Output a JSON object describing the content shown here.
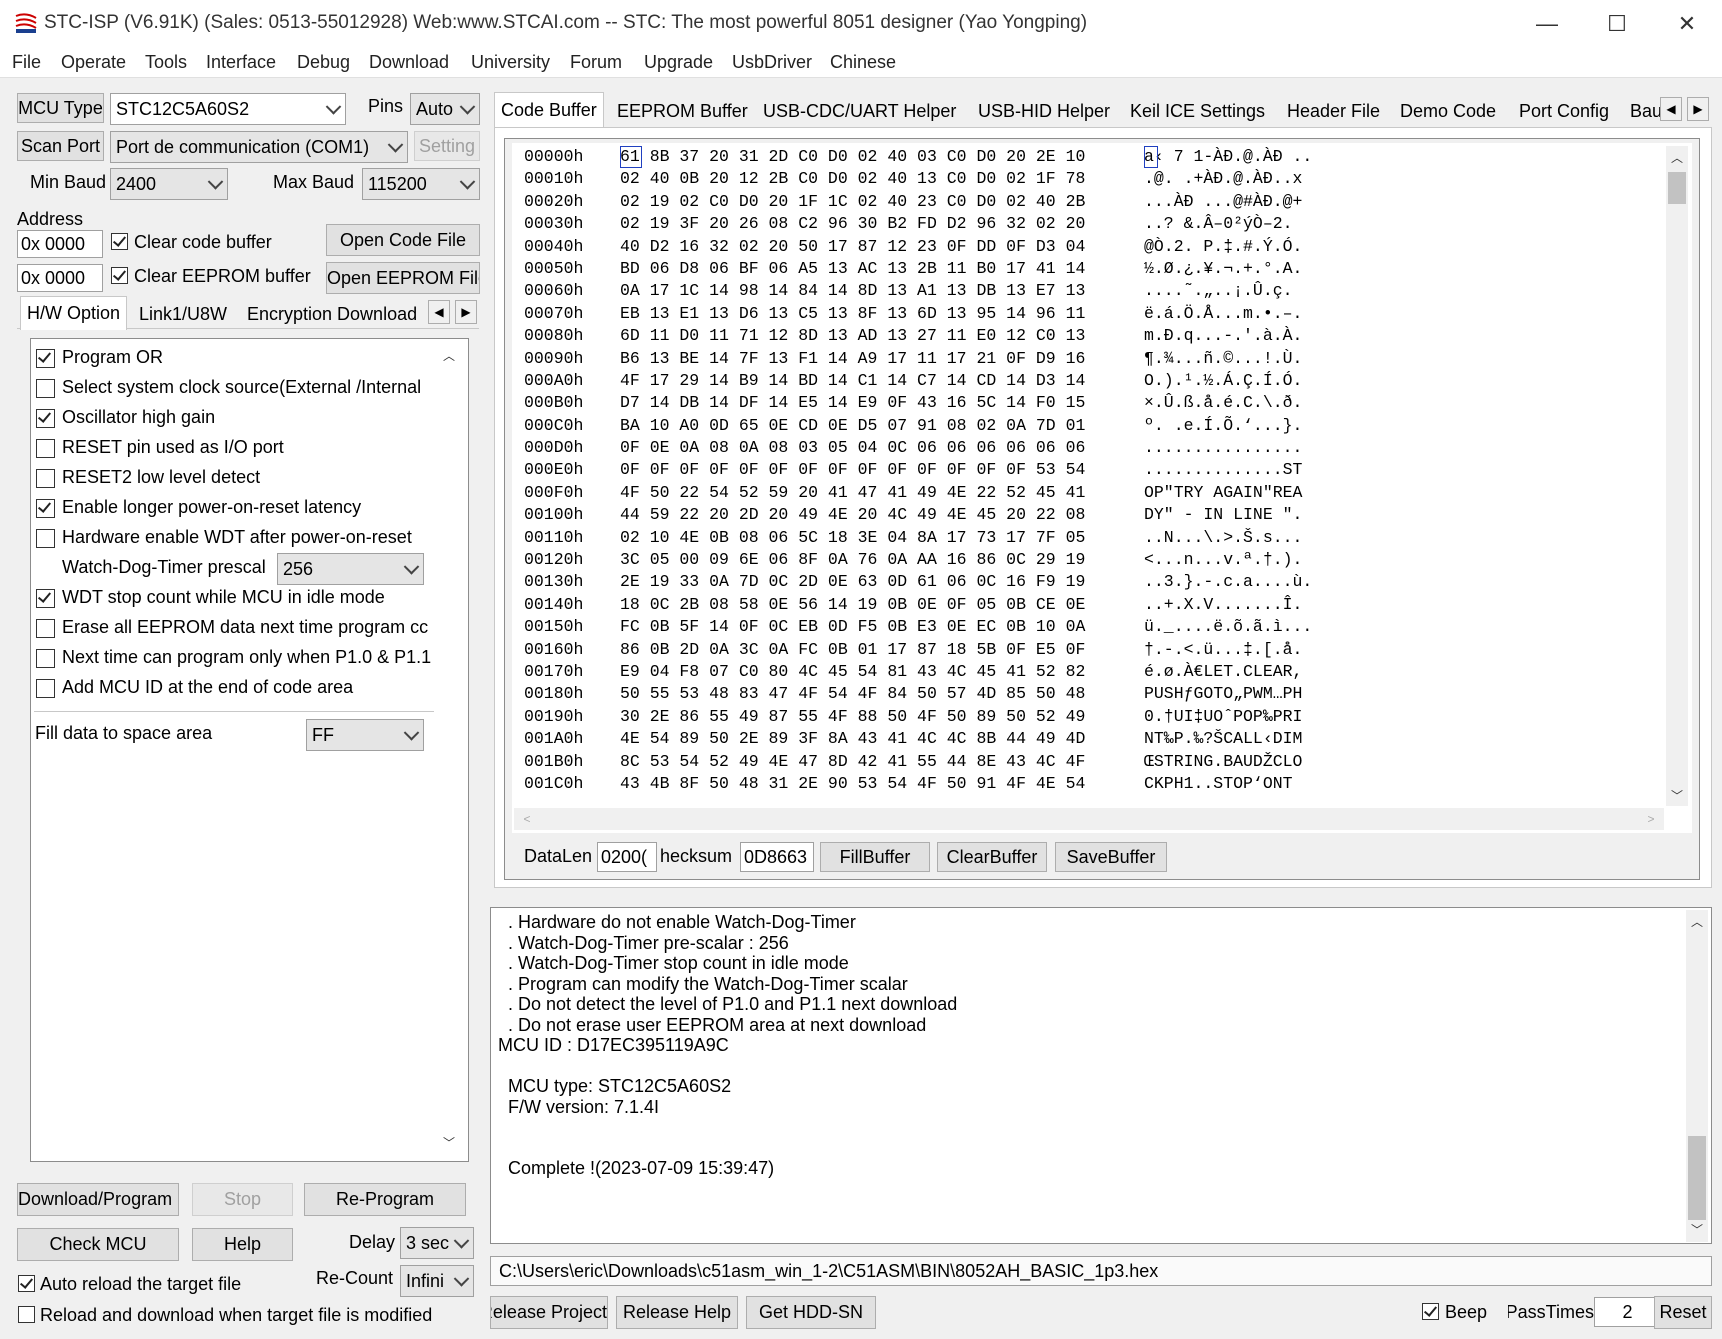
{
  "window": {
    "title": "STC-ISP (V6.91K) (Sales: 0513-55012928) Web:www.STCAI.com  -- STC: The most powerful 8051 designer (Yao Yongping)",
    "minimize": "—",
    "maximize": "☐",
    "close": "✕"
  },
  "menu": [
    "File",
    "Operate",
    "Tools",
    "Interface",
    "Debug",
    "Download",
    "University",
    "Forum",
    "Upgrade",
    "UsbDriver",
    "Chinese"
  ],
  "left": {
    "mcu_type_label": "MCU Type",
    "mcu_type_value": "STC12C5A60S2",
    "pins_label": "Pins",
    "pins_value": "Auto",
    "scan_port_label": "Scan Port",
    "port_value": "Port de communication (COM1)",
    "setting_label": "Setting",
    "min_baud_label": "Min Baud",
    "min_baud_value": "2400",
    "max_baud_label": "Max Baud",
    "max_baud_value": "115200",
    "address_label": "Address",
    "addr1": "0x 0000",
    "addr2": "0x 0000",
    "clear_code_label": "Clear code buffer",
    "clear_eeprom_label": "Clear EEPROM buffer",
    "open_code_file": "Open Code File",
    "open_eeprom_file": "Open EEPROM File",
    "tabs": [
      "H/W Option",
      "Link1/U8W",
      "Encryption Download"
    ],
    "options": [
      {
        "label": "Program OR",
        "checked": true
      },
      {
        "label": "Select system clock source(External /Internal",
        "checked": false
      },
      {
        "label": "Oscillator high gain",
        "checked": true
      },
      {
        "label": "RESET pin used as I/O port",
        "checked": false
      },
      {
        "label": "RESET2 low level detect",
        "checked": false
      },
      {
        "label": "Enable longer power-on-reset latency",
        "checked": true
      },
      {
        "label": "Hardware enable WDT after power-on-reset",
        "checked": false
      }
    ],
    "wdt_prescale_label": "Watch-Dog-Timer prescal",
    "wdt_prescale_value": "256",
    "options2": [
      {
        "label": "WDT stop count while MCU in idle mode",
        "checked": true
      },
      {
        "label": "Erase all EEPROM data next time program cc",
        "checked": false
      },
      {
        "label": "Next time can program only when P1.0 & P1.1",
        "checked": false
      },
      {
        "label": "Add MCU ID at the end of code area",
        "checked": false
      }
    ],
    "fill_label": "Fill data to space area",
    "fill_value": "FF",
    "download_program": "Download/Program",
    "stop": "Stop",
    "re_program": "Re-Program",
    "check_mcu": "Check MCU",
    "help": "Help",
    "delay_label": "Delay",
    "delay_value": "3 sec",
    "recount_label": "Re-Count",
    "recount_value": "Infini",
    "auto_reload_label": "Auto reload the target file",
    "reload_modified_label": "Reload and download when target file is modified"
  },
  "right": {
    "tabs": [
      "Code Buffer",
      "EEPROM Buffer",
      "USB-CDC/UART Helper",
      "USB-HID Helper",
      "Keil ICE Settings",
      "Header File",
      "Demo Code",
      "Port Config",
      "Bau"
    ],
    "hex_rows": [
      {
        "addr": "00000h",
        "bytes": "61 8B 37 20 31 2D C0 D0 02 40 03 C0 D0 20 2E 10",
        "ascii": "a‹ 7 1-ÀÐ.@.ÀÐ .."
      },
      {
        "addr": "00010h",
        "bytes": "02 40 0B 20 12 2B C0 D0 02 40 13 C0 D0 02 1F 78",
        "ascii": ".@. .+ÀÐ.@.ÀÐ..x"
      },
      {
        "addr": "00020h",
        "bytes": "02 19 02 C0 D0 20 1F 1C 02 40 23 C0 D0 02 40 2B",
        "ascii": "...ÀÐ ...@#ÀÐ.@+"
      },
      {
        "addr": "00030h",
        "bytes": "02 19 3F 20 26 08 C2 96 30 B2 FD D2 96 32 02 20",
        "ascii": "..? &.Â–0²ýÒ–2. "
      },
      {
        "addr": "00040h",
        "bytes": "40 D2 16 32 02 20 50 17 87 12 23 0F DD 0F D3 04",
        "ascii": "@Ò.2. P.‡.#.Ý.Ó."
      },
      {
        "addr": "00050h",
        "bytes": "BD 06 D8 06 BF 06 A5 13 AC 13 2B 11 B0 17 41 14",
        "ascii": "½.Ø.¿.¥.¬.+.°.A."
      },
      {
        "addr": "00060h",
        "bytes": "0A 17 1C 14 98 14 84 14 8D 13 A1 13 DB 13 E7 13",
        "ascii": "....˜.„..¡.Û.ç."
      },
      {
        "addr": "00070h",
        "bytes": "EB 13 E1 13 D6 13 C5 13 8F 13 6D 13 95 14 96 11",
        "ascii": "ë.á.Ö.Å...m.•.–."
      },
      {
        "addr": "00080h",
        "bytes": "6D 11 D0 11 71 12 8D 13 AD 13 27 11 E0 12 C0 13",
        "ascii": "m.Ð.q...-.'.à.À."
      },
      {
        "addr": "00090h",
        "bytes": "B6 13 BE 14 7F 13 F1 14 A9 17 11 17 21 0F D9 16",
        "ascii": "¶.¾...ñ.©...!.Ù."
      },
      {
        "addr": "000A0h",
        "bytes": "4F 17 29 14 B9 14 BD 14 C1 14 C7 14 CD 14 D3 14",
        "ascii": "O.).¹.½.Á.Ç.Í.Ó."
      },
      {
        "addr": "000B0h",
        "bytes": "D7 14 DB 14 DF 14 E5 14 E9 0F 43 16 5C 14 F0 15",
        "ascii": "×.Û.ß.å.é.C.\\.ð."
      },
      {
        "addr": "000C0h",
        "bytes": "BA 10 A0 0D 65 0E CD 0E D5 07 91 08 02 0A 7D 01",
        "ascii": "º. .e.Í.Õ.‘...}."
      },
      {
        "addr": "000D0h",
        "bytes": "0F 0E 0A 08 0A 08 03 05 04 0C 06 06 06 06 06 06",
        "ascii": "................"
      },
      {
        "addr": "000E0h",
        "bytes": "0F 0F 0F 0F 0F 0F 0F 0F 0F 0F 0F 0F 0F 0F 53 54",
        "ascii": "..............ST"
      },
      {
        "addr": "000F0h",
        "bytes": "4F 50 22 54 52 59 20 41 47 41 49 4E 22 52 45 41",
        "ascii": "OP\"TRY AGAIN\"REA"
      },
      {
        "addr": "00100h",
        "bytes": "44 59 22 20 2D 20 49 4E 20 4C 49 4E 45 20 22 08",
        "ascii": "DY\" - IN LINE \"."
      },
      {
        "addr": "00110h",
        "bytes": "02 10 4E 0B 08 06 5C 18 3E 04 8A 17 73 17 7F 05",
        "ascii": "..N...\\.>.Š.s..."
      },
      {
        "addr": "00120h",
        "bytes": "3C 05 00 09 6E 06 8F 0A 76 0A AA 16 86 0C 29 19",
        "ascii": "<...n...v.ª.†.)."
      },
      {
        "addr": "00130h",
        "bytes": "2E 19 33 0A 7D 0C 2D 0E 63 0D 61 06 0C 16 F9 19",
        "ascii": "..3.}.-.c.a....ù."
      },
      {
        "addr": "00140h",
        "bytes": "18 0C 2B 08 58 0E 56 14 19 0B 0E 0F 05 0B CE 0E",
        "ascii": "..+.X.V.......Î."
      },
      {
        "addr": "00150h",
        "bytes": "FC 0B 5F 14 0F 0C EB 0D F5 0B E3 0E EC 0B 10 0A",
        "ascii": "ü._....ë.õ.ã.ì..."
      },
      {
        "addr": "00160h",
        "bytes": "86 0B 2D 0A 3C 0A FC 0B 01 17 87 18 5B 0F E5 0F",
        "ascii": "†.-.<.ü...‡.[.å."
      },
      {
        "addr": "00170h",
        "bytes": "E9 04 F8 07 C0 80 4C 45 54 81 43 4C 45 41 52 82",
        "ascii": "é.ø.À€LET.CLEAR,"
      },
      {
        "addr": "00180h",
        "bytes": "50 55 53 48 83 47 4F 54 4F 84 50 57 4D 85 50 48",
        "ascii": "PUSHƒGOTO„PWM…PH"
      },
      {
        "addr": "00190h",
        "bytes": "30 2E 86 55 49 87 55 4F 88 50 4F 50 89 50 52 49",
        "ascii": "0.†UI‡UOˆPOP‰PRI"
      },
      {
        "addr": "001A0h",
        "bytes": "4E 54 89 50 2E 89 3F 8A 43 41 4C 4C 8B 44 49 4D",
        "ascii": "NT‰P.‰?ŠCALL‹DIM"
      },
      {
        "addr": "001B0h",
        "bytes": "8C 53 54 52 49 4E 47 8D 42 41 55 44 8E 43 4C 4F",
        "ascii": "ŒSTRING.BAUDŽCLO"
      },
      {
        "addr": "001C0h",
        "bytes": "43 4B 8F 50 48 31 2E 90 53 54 4F 50 91 4F 4E 54",
        "ascii": "CKPH1..STOP‘ONT"
      }
    ],
    "datalen_label": "DataLen",
    "datalen_value": "0200(",
    "checksum_label": "hecksum",
    "checksum_value": "0D8663",
    "fill_buffer": "FillBuffer",
    "clear_buffer": "ClearBuffer",
    "save_buffer": "SaveBuffer",
    "log_lines": [
      "  . Hardware do not enable Watch-Dog-Timer",
      "  . Watch-Dog-Timer pre-scalar : 256",
      "  . Watch-Dog-Timer stop count in idle mode",
      "  . Program can modify the Watch-Dog-Timer scalar",
      "  . Do not detect the level of P1.0 and P1.1 next download",
      "  . Do not erase user EEPROM area at next download",
      "MCU ID : D17EC395119A9C",
      "",
      "  MCU type: STC12C5A60S2",
      "  F/W version: 7.1.4I",
      "",
      "",
      "  Complete !(2023-07-09 15:39:47)"
    ],
    "file_path": "C:\\Users\\eric\\Downloads\\c51asm_win_1-2\\C51ASM\\BIN\\8052AH_BASIC_1p3.hex",
    "release_project": "Release Project",
    "release_help": "Release Help",
    "get_hdd_sn": "Get HDD-SN",
    "beep_label": "Beep",
    "pass_times_label": "PassTimes",
    "pass_times_value": "2",
    "reset": "Reset"
  }
}
